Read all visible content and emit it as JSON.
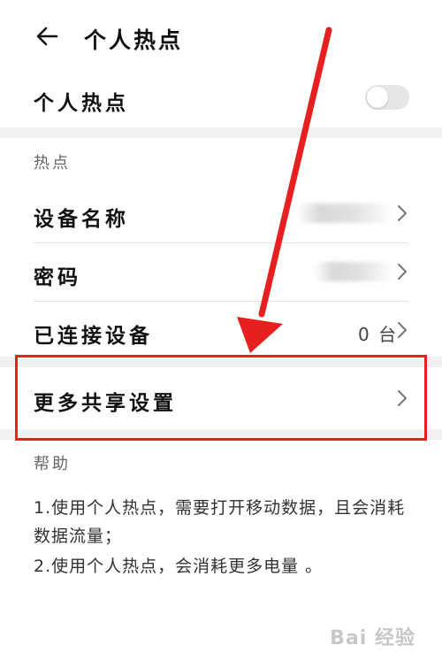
{
  "header": {
    "title": "个人热点",
    "back_icon": "back-arrow-icon"
  },
  "hotspot_toggle": {
    "label": "个人热点",
    "enabled": false
  },
  "hotspot_section": {
    "header": "热点",
    "items": [
      {
        "label": "设备名称",
        "value": ""
      },
      {
        "label": "密码",
        "value": ""
      },
      {
        "label": "已连接设备",
        "value": "0 台"
      }
    ]
  },
  "more_sharing": {
    "label": "更多共享设置"
  },
  "help_section": {
    "header": "帮助",
    "items": [
      "1.使用个人热点，需要打开移动数据，且会消耗数据流量；",
      "2.使用个人热点，会消耗更多电量 。"
    ]
  },
  "watermark": {
    "text": "Bai 经验"
  },
  "colors": {
    "annotation_red": "#e62020",
    "section_gray": "#f1f1f1"
  }
}
